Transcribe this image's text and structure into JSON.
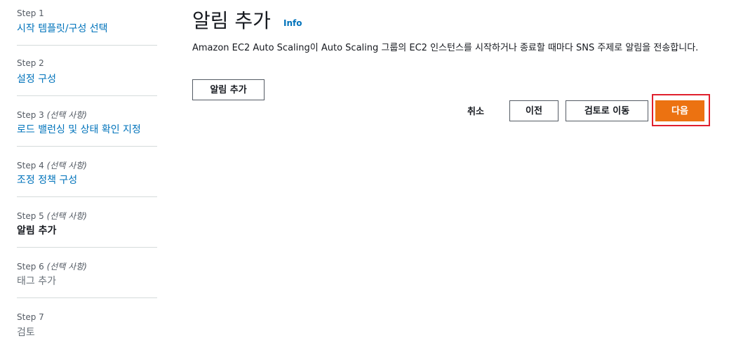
{
  "wizard": {
    "steps": [
      {
        "label": "Step 1",
        "optional": "",
        "title": "시작 템플릿/구성 선택",
        "state": "link"
      },
      {
        "label": "Step 2",
        "optional": "",
        "title": "설정 구성",
        "state": "link"
      },
      {
        "label": "Step 3",
        "optional": "(선택 사항)",
        "title": "로드 밸런싱 및 상태 확인 지정",
        "state": "link"
      },
      {
        "label": "Step 4",
        "optional": "(선택 사항)",
        "title": "조정 정책 구성",
        "state": "link"
      },
      {
        "label": "Step 5",
        "optional": "(선택 사항)",
        "title": "알림 추가",
        "state": "active"
      },
      {
        "label": "Step 6",
        "optional": "(선택 사항)",
        "title": "태그 추가",
        "state": "disabled"
      },
      {
        "label": "Step 7",
        "optional": "",
        "title": "검토",
        "state": "disabled"
      }
    ]
  },
  "main": {
    "title": "알림 추가",
    "info": "Info",
    "description": "Amazon EC2 Auto Scaling이 Auto Scaling 그룹의 EC2 인스턴스를 시작하거나 종료할 때마다 SNS 주제로 알림을 전송합니다.",
    "add_notification_label": "알림 추가"
  },
  "footer": {
    "cancel_label": "취소",
    "previous_label": "이전",
    "review_label": "검토로 이동",
    "next_label": "다음"
  },
  "colors": {
    "primary": "#ec7211",
    "link": "#0073bb",
    "highlight": "#e0202d"
  }
}
